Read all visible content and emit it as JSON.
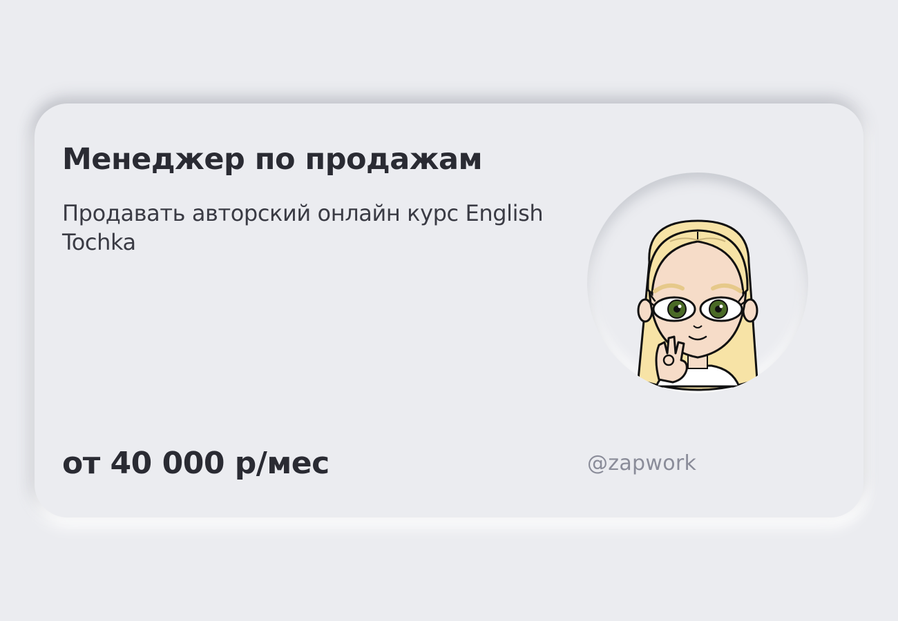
{
  "card": {
    "title": "Менеджер по продажам",
    "description": "Продавать авторский онлайн курс English Tochka",
    "salary": "от 40 000 р/мес",
    "handle": "@zapwork"
  },
  "avatar": {
    "icon": "cartoon-girl-avatar",
    "colors": {
      "hair": "#f7e3a6",
      "skin": "#f6dcc8",
      "eyes": "#4a6a26",
      "outline": "#111111",
      "shirt": "#ffffff"
    }
  },
  "theme": {
    "background": "#ebecf0",
    "text": "#2a2b33",
    "muted": "#8a8c99"
  }
}
